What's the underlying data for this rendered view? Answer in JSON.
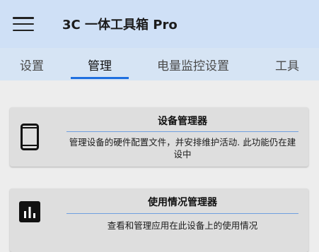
{
  "app_bar": {
    "title": "3C 一体工具箱 Pro",
    "menu_icon": "hamburger-menu-icon"
  },
  "tabs": [
    {
      "label": "设置",
      "active": false
    },
    {
      "label": "管理",
      "active": true
    },
    {
      "label": "电量监控设置",
      "active": false
    },
    {
      "label": "工具",
      "active": false
    }
  ],
  "cards": [
    {
      "title": "设备管理器",
      "description": "管理设备的硬件配置文件，并安排维护活动. 此功能仍在建设中",
      "icon": "smartphone-icon"
    },
    {
      "title": "使用情况管理器",
      "description": "查看和管理应用在此设备上的使用情况",
      "icon": "bar-chart-icon"
    }
  ],
  "colors": {
    "app_bar": "#cfe0f6",
    "tab_bar": "#d6e4f4",
    "accent": "#1f6fe0",
    "background": "#ededed",
    "card": "#dedede"
  }
}
